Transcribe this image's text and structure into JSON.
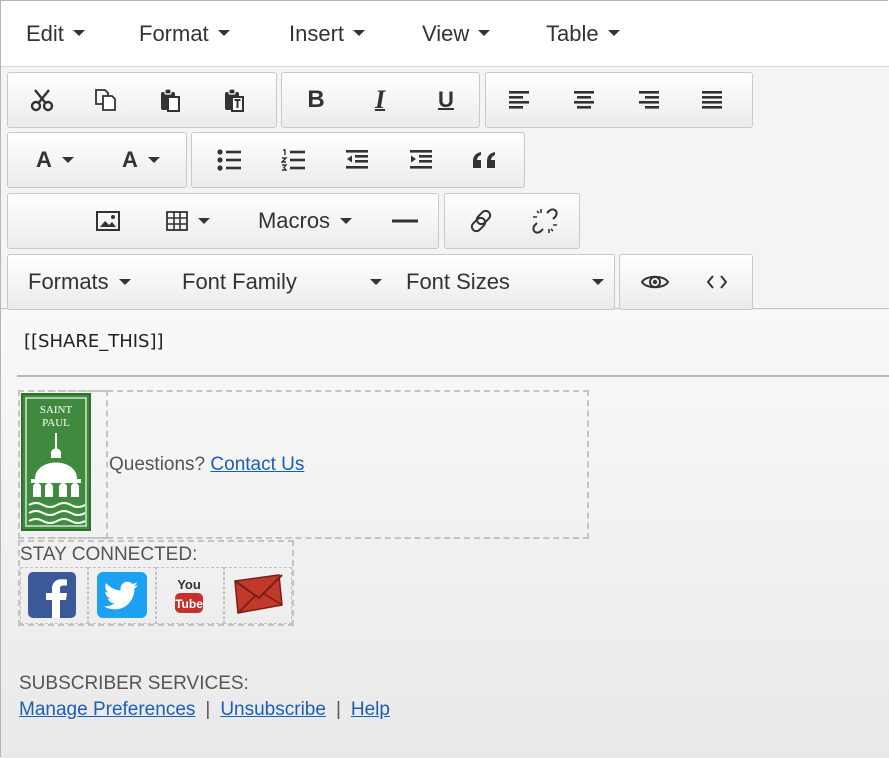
{
  "menubar": {
    "items": [
      {
        "label": "Edit"
      },
      {
        "label": "Format"
      },
      {
        "label": "Insert"
      },
      {
        "label": "View"
      },
      {
        "label": "Table"
      }
    ]
  },
  "toolbar": {
    "macros_label": "Macros",
    "formats_label": "Formats",
    "font_family_label": "Font Family",
    "font_sizes_label": "Font Sizes",
    "text_color_label": "A",
    "bg_color_label": "A",
    "bold_label": "B",
    "italic_label": "I",
    "underline_label": "U"
  },
  "content": {
    "share_tag": "[[SHARE_THIS]]",
    "logo_text_line1": "SAINT",
    "logo_text_line2": "PAUL",
    "questions_text": "Questions?",
    "contact_link": "Contact Us",
    "stay_connected": "STAY CONNECTED:",
    "youtube_text_top": "You",
    "youtube_text_bottom": "Tube",
    "subscriber_services": "SUBSCRIBER SERVICES:",
    "links": {
      "manage": "Manage Preferences",
      "unsubscribe": "Unsubscribe",
      "help": "Help"
    },
    "separator": "|"
  },
  "colors": {
    "link": "#1a5fb4",
    "logo_green": "#3f8a3f",
    "facebook": "#3b5998",
    "twitter": "#1da1f2",
    "youtube": "#c4302b",
    "email": "#c0392b"
  }
}
